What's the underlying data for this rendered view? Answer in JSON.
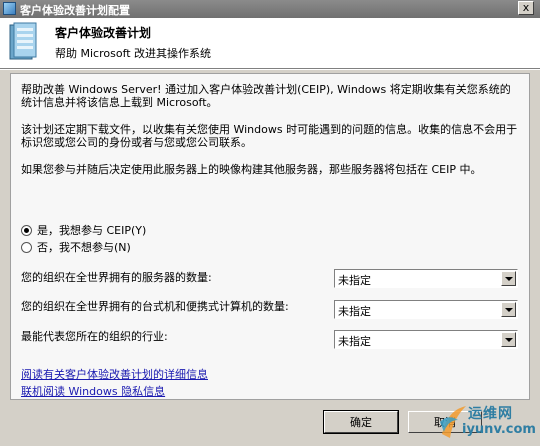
{
  "window": {
    "title": "客户体验改善计划配置",
    "close_glyph": "x"
  },
  "header": {
    "title": "客户体验改善计划",
    "subtitle": "帮助 Microsoft 改进其操作系统"
  },
  "content": {
    "paragraph1": "帮助改善 Windows Server! 通过加入客户体验改善计划(CEIP), Windows 将定期收集有关您系统的统计信息并将该信息上载到 Microsoft。",
    "paragraph2": "该计划还定期下载文件，以收集有关您使用 Windows 时可能遇到的问题的信息。收集的信息不会用于标识您或您公司的身份或者与您或您公司联系。",
    "paragraph3": "如果您参与并随后决定使用此服务器上的映像构建其他服务器，那些服务器将包括在 CEIP 中。",
    "radio_yes": {
      "label": "是，我想参与 CEIP(Y)",
      "checked": true
    },
    "radio_no": {
      "label": "否，我不想参与(N)",
      "checked": false
    },
    "fields": [
      {
        "label": "您的组织在全世界拥有的服务器的数量:",
        "value": "未指定"
      },
      {
        "label": "您的组织在全世界拥有的台式机和便携式计算机的数量:",
        "value": "未指定"
      },
      {
        "label": "最能代表您所在的组织的行业:",
        "value": "未指定"
      }
    ],
    "link_details": "阅读有关客户体验改善计划的详细信息",
    "link_privacy": "联机阅读 Windows 隐私信息"
  },
  "buttons": {
    "ok": "确定",
    "cancel": "取消"
  },
  "watermark": {
    "line1": "运维网",
    "line2": "iyunv.com"
  }
}
